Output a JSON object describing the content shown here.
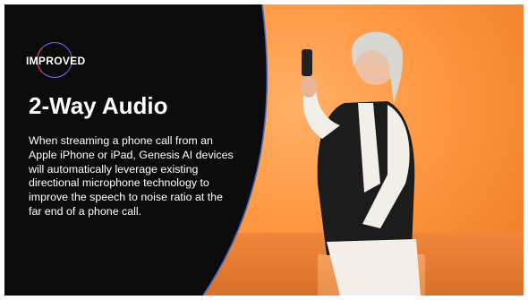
{
  "slide": {
    "badge": "IMPROVED",
    "title": "2-Way Audio",
    "body": "When streaming a phone call from an Apple iPhone or iPad, Genesis AI devices will automatically leverage existing directional microphone technology to improve the speech to noise ratio at the far end of a phone call."
  },
  "colors": {
    "panel": "#0b0b0b",
    "accent_edge": "#3a6bd6",
    "photo_background": "#ff9a45",
    "text": "#ffffff"
  }
}
